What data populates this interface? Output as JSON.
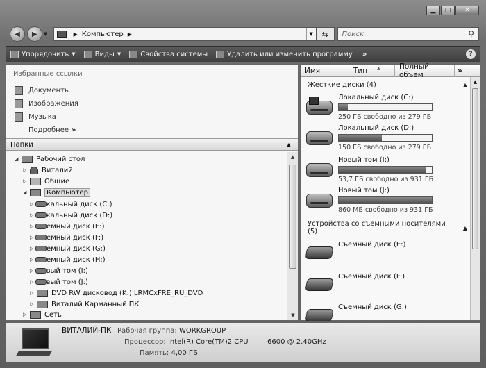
{
  "window": {
    "min": "▁",
    "max": "□",
    "close": "✕"
  },
  "address": {
    "location": "Компьютер",
    "search_placeholder": "Поиск"
  },
  "toolbar": {
    "organize": "Упорядочить",
    "views": "Виды",
    "system_properties": "Свойства системы",
    "uninstall": "Удалить или изменить программу",
    "more": "»"
  },
  "favorites": {
    "title": "Избранные ссылки",
    "items": [
      "Документы",
      "Изображения",
      "Музыка"
    ],
    "more": "Подробнее",
    "more_chev": "»"
  },
  "folders": {
    "title": "Папки",
    "tree": [
      "Рабочий стол",
      "Виталий",
      "Общие",
      "Компьютер",
      "Локальный диск (C:)",
      "Локальный диск (D:)",
      "Съемный диск (E:)",
      "Съемный диск (F:)",
      "Съемный диск (G:)",
      "Съемный диск (H:)",
      "Новый том (I:)",
      "Новый том (J:)",
      "DVD RW дисковод (K:) LRMCxFRE_RU_DVD",
      "Виталий Карманный ПК",
      "Сеть"
    ]
  },
  "columns": {
    "name": "Имя",
    "type": "Тип",
    "total": "Полный объем",
    "more": "»"
  },
  "hard_drives": {
    "group": "Жесткие диски (4)",
    "items": [
      {
        "name": "Локальный диск (C:)",
        "free": "250 ГБ свободно из 279 ГБ",
        "used_fraction": 0.1
      },
      {
        "name": "Локальный диск (D:)",
        "free": "150 ГБ свободно из 279 ГБ",
        "used_fraction": 0.46
      },
      {
        "name": "Новый том (I:)",
        "free": "53,7 ГБ свободно из 931 ГБ",
        "used_fraction": 0.94
      },
      {
        "name": "Новый том (J:)",
        "free": "860 МБ свободно из 931 ГБ",
        "used_fraction": 0.999
      }
    ]
  },
  "removable": {
    "group": "Устройства со съемными носителями (5)",
    "items": [
      "Съемный диск (E:)",
      "Съемный диск (F:)",
      "Съемный диск (G:)"
    ]
  },
  "details": {
    "computer_name": "ВИТАЛИЙ-ПК",
    "workgroup_label": "Рабочая группа:",
    "workgroup": "WORKGROUP",
    "cpu_label": "Процессор:",
    "cpu": "Intel(R) Core(TM)2 CPU",
    "cpu_model": "6600  @ 2.40GHz",
    "memory_label": "Память:",
    "memory": "4,00 ГБ"
  }
}
